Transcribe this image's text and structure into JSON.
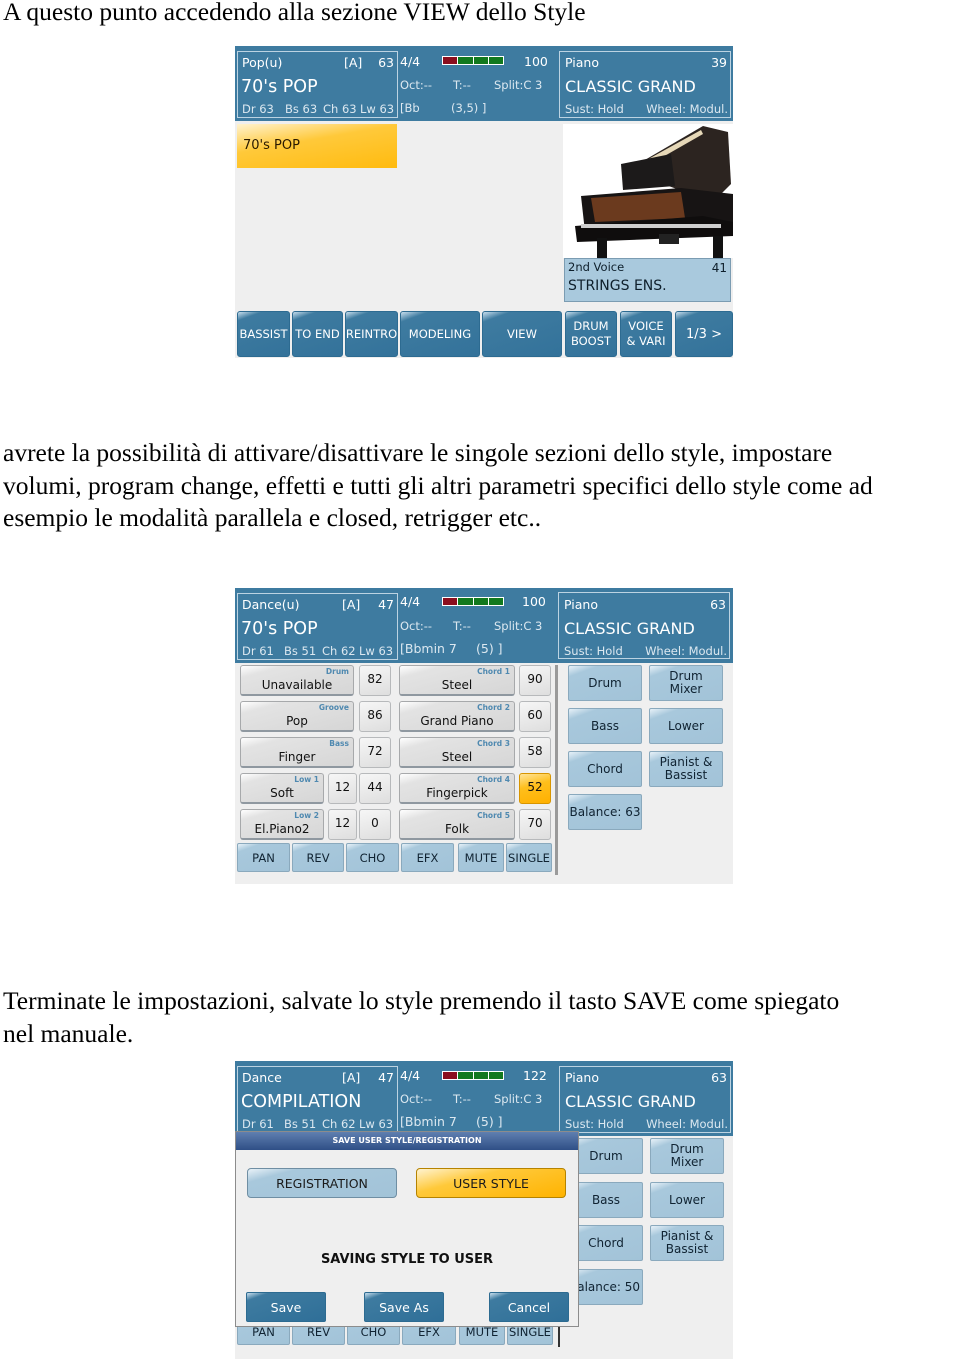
{
  "paragraphs": {
    "intro": "A questo punto accedendo alla sezione VIEW dello Style",
    "middle_line1": "avrete la possibilità di attivare/disattivare le singole sezioni dello style, impostare",
    "middle_line2": "volumi, program change, effetti e tutti gli altri parametri specifici dello style come ad",
    "middle_line3": "esempio le modalità parallela e closed, retrigger etc..",
    "closing_line1": "Terminate le impostazioni, salvate lo style premendo il tasto SAVE come spiegato",
    "closing_line2": "nel manuale."
  },
  "screens": [
    {
      "header": {
        "style_category": "Pop(u)",
        "style_bank": "[A]",
        "style_number": "63",
        "style_name": "70's POP",
        "volumes": {
          "dr": "Dr 63",
          "bs": "Bs 63",
          "ch": "Ch 63",
          "lw": "Lw 63"
        },
        "time_signature": "4/4",
        "tempo": "100",
        "octave": "Oct:--",
        "transpose": "T:--",
        "split": "Split:C 3",
        "chord_left": "[Bb",
        "chord_right": "(3,5) ]",
        "voice_category": "Piano",
        "voice_number": "39",
        "voice_name": "CLASSIC GRAND",
        "sustain": "Sust: Hold",
        "wheel": "Wheel: Modul.",
        "meter_colors": [
          "#8b0e1e",
          "#12791e",
          "#12791e",
          "#12791e"
        ]
      },
      "selected_style_chip": "70's POP",
      "second_voice": {
        "label": "2nd Voice",
        "number": "41",
        "name": "STRINGS ENS."
      },
      "bottom_buttons": [
        "BASSIST",
        "TO END",
        "REINTRO",
        "MODELING",
        "VIEW",
        "DRUM BOOST",
        "VOICE & VARI",
        "1/3 >"
      ]
    },
    {
      "header": {
        "style_category": "Dance(u)",
        "style_bank": "[A]",
        "style_number": "47",
        "style_name": "70's POP",
        "volumes": {
          "dr": "Dr 61",
          "bs": "Bs 51",
          "ch": "Ch 62",
          "lw": "Lw 63"
        },
        "time_signature": "4/4",
        "tempo": "100",
        "octave": "Oct:--",
        "transpose": "T:--",
        "split": "Split:C 3",
        "chord_left": "[Bbmin 7",
        "chord_right": "(5) ]",
        "voice_category": "Piano",
        "voice_number": "63",
        "voice_name": "CLASSIC GRAND",
        "sustain": "Sust: Hold",
        "wheel": "Wheel: Modul."
      },
      "left_tracks": [
        {
          "tag": "Drum",
          "name": "Unavailable",
          "values": [
            "82"
          ]
        },
        {
          "tag": "Groove",
          "name": "Pop",
          "values": [
            "86"
          ]
        },
        {
          "tag": "Bass",
          "name": "Finger",
          "values": [
            "72"
          ]
        },
        {
          "tag": "Low 1",
          "name": "Soft",
          "values": [
            "12",
            "44"
          ]
        },
        {
          "tag": "Low 2",
          "name": "El.Piano2",
          "values": [
            "12",
            "0"
          ]
        }
      ],
      "chord_tracks": [
        {
          "tag": "Chord 1",
          "name": "Steel",
          "value": "90",
          "selected": false
        },
        {
          "tag": "Chord 2",
          "name": "Grand Piano",
          "value": "60",
          "selected": false
        },
        {
          "tag": "Chord 3",
          "name": "Steel",
          "value": "58",
          "selected": false
        },
        {
          "tag": "Chord 4",
          "name": "Fingerpick",
          "value": "52",
          "selected": true
        },
        {
          "tag": "Chord 5",
          "name": "Folk",
          "value": "70",
          "selected": false
        }
      ],
      "side_buttons": [
        "Drum",
        "Drum Mixer",
        "Bass",
        "Lower",
        "Chord",
        "Pianist & Bassist",
        "Balance: 63"
      ],
      "tabs": [
        "PAN",
        "REV",
        "CHO",
        "EFX",
        "MUTE",
        "SINGLE"
      ]
    },
    {
      "header": {
        "style_category": "Dance",
        "style_bank": "[A]",
        "style_number": "47",
        "style_name": "COMPILATION",
        "volumes": {
          "dr": "Dr 61",
          "bs": "Bs 51",
          "ch": "Ch 62",
          "lw": "Lw 63"
        },
        "time_signature": "4/4",
        "tempo": "122",
        "octave": "Oct:--",
        "transpose": "T:--",
        "split": "Split:C 3",
        "chord_left": "[Bbmin 7",
        "chord_right": "(5) ]",
        "voice_category": "Piano",
        "voice_number": "63",
        "voice_name": "CLASSIC GRAND",
        "sustain": "Sust: Hold",
        "wheel": "Wheel: Modul."
      },
      "side_buttons": [
        "Drum",
        "Drum Mixer",
        "Bass",
        "Lower",
        "Chord",
        "Pianist & Bassist",
        "alance: 50"
      ],
      "tabs": [
        "PAN",
        "REV",
        "CHO",
        "EFX",
        "MUTE",
        "SINGLE"
      ],
      "dialog": {
        "title": "SAVE USER STYLE/REGISTRATION",
        "option_registration": "REGISTRATION",
        "option_user_style": "USER STYLE",
        "message": "SAVING STYLE TO USER",
        "save": "Save",
        "save_as": "Save As",
        "cancel": "Cancel"
      }
    }
  ]
}
